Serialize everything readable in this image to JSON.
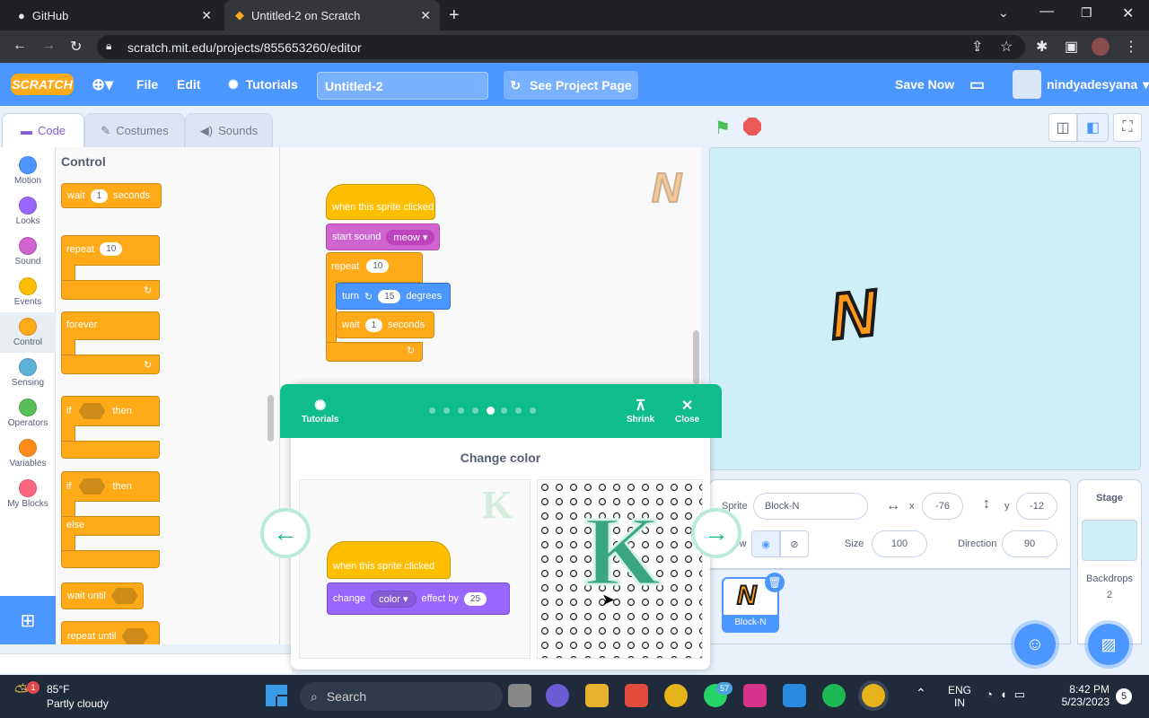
{
  "browser": {
    "tabs": [
      {
        "label": "GitHub",
        "active": false
      },
      {
        "label": "Untitled-2 on Scratch",
        "active": true
      }
    ],
    "url": "scratch.mit.edu/projects/855653260/editor"
  },
  "header": {
    "logo": "SCRATCH",
    "file": "File",
    "edit": "Edit",
    "tutorials": "Tutorials",
    "project_title": "Untitled-2",
    "see_project": "See Project Page",
    "save_now": "Save Now",
    "username": "nindyadesyana"
  },
  "editor_tabs": {
    "code": "Code",
    "costumes": "Costumes",
    "sounds": "Sounds"
  },
  "categories": [
    {
      "label": "Motion",
      "color": "#4c97ff"
    },
    {
      "label": "Looks",
      "color": "#9966ff"
    },
    {
      "label": "Sound",
      "color": "#cf63cf"
    },
    {
      "label": "Events",
      "color": "#ffbf00"
    },
    {
      "label": "Control",
      "color": "#ffab19"
    },
    {
      "label": "Sensing",
      "color": "#5cb1d6"
    },
    {
      "label": "Operators",
      "color": "#59c059"
    },
    {
      "label": "Variables",
      "color": "#ff8c1a"
    },
    {
      "label": "My Blocks",
      "color": "#ff6680"
    }
  ],
  "palette": {
    "heading": "Control",
    "wait": "wait",
    "wait_val": "1",
    "seconds": "seconds",
    "repeat": "repeat",
    "repeat_val": "10",
    "forever": "forever",
    "if": "if",
    "then": "then",
    "else": "else",
    "wait_until": "wait until",
    "repeat_until": "repeat until"
  },
  "script": {
    "hat": "when this sprite clicked",
    "start_sound": "start sound",
    "sound_name": "meow",
    "repeat": "repeat",
    "repeat_val": "10",
    "turn": "turn",
    "turn_val": "15",
    "degrees": "degrees",
    "wait": "wait",
    "wait_val": "1",
    "seconds": "seconds",
    "sprite_letter": "N"
  },
  "stage": {
    "sprite_letter": "N"
  },
  "sprite_info": {
    "sprite_label": "Sprite",
    "sprite_name": "Block-N",
    "x_label": "x",
    "x_val": "-76",
    "y_label": "y",
    "y_val": "-12",
    "show_label": "Show",
    "size_label": "Size",
    "size_val": "100",
    "direction_label": "Direction",
    "direction_val": "90",
    "sprite_thumb_name": "Block-N"
  },
  "stage_panel": {
    "title": "Stage",
    "backdrops_label": "Backdrops",
    "backdrops_count": "2"
  },
  "tutorial": {
    "tutorials_label": "Tutorials",
    "shrink": "Shrink",
    "close": "Close",
    "step_title": "Change color",
    "hat": "when this sprite clicked",
    "change": "change",
    "effect": "color",
    "effect_by": "effect by",
    "value": "25",
    "letter": "K",
    "total_steps": 8,
    "current_step": 5
  },
  "taskbar": {
    "temp": "85°F",
    "weather": "Partly cloudy",
    "search": "Search",
    "lang1": "ENG",
    "lang2": "IN",
    "time": "8:42 PM",
    "date": "5/23/2023",
    "notif_count": "5",
    "whatsapp_badge": "57",
    "weather_badge": "1"
  }
}
